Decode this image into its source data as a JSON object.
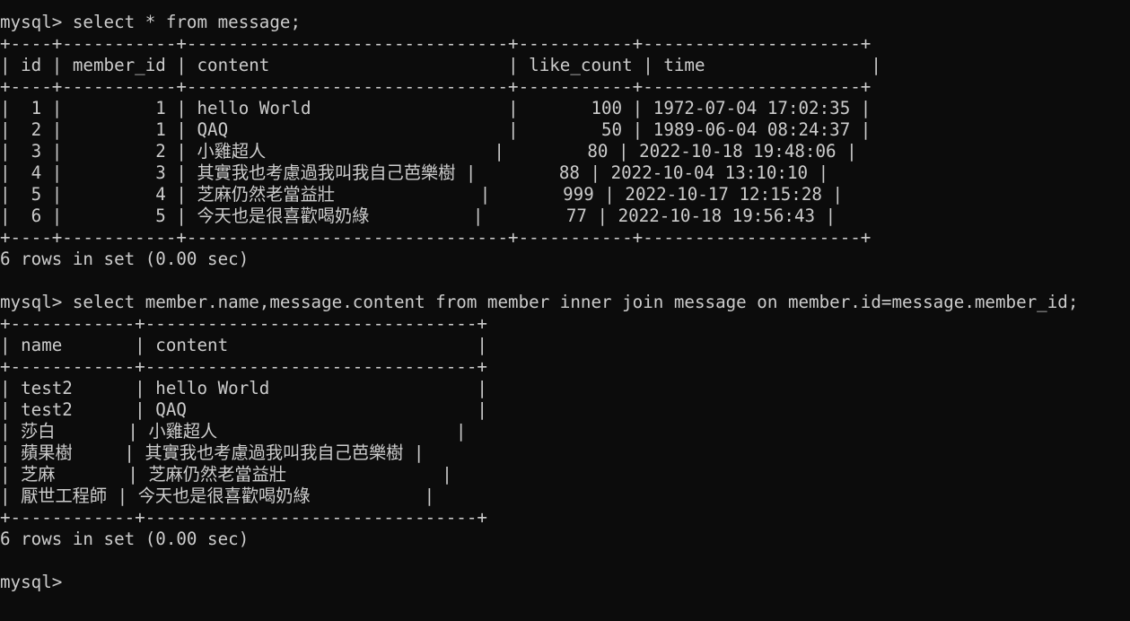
{
  "theme": {
    "background": "#0c0c0c",
    "foreground": "#cccccc"
  },
  "lines": [
    "mysql> select * from message;",
    "+----+-----------+-------------------------------+-----------+---------------------+",
    "| id | member_id | content                       | like_count | time                |",
    "+----+-----------+-------------------------------+-----------+---------------------+",
    "|  1 |         1 | hello World                   |       100 | 1972-07-04 17:02:35 |",
    "|  2 |         1 | QAQ                           |        50 | 1989-06-04 08:24:37 |",
    "|  3 |         2 | 小雞超人                      |        80 | 2022-10-18 19:48:06 |",
    "|  4 |         3 | 其實我也考慮過我叫我自己芭樂樹 |        88 | 2022-10-04 13:10:10 |",
    "|  5 |         4 | 芝麻仍然老當益壯              |       999 | 2022-10-17 12:15:28 |",
    "|  6 |         5 | 今天也是很喜歡喝奶綠          |        77 | 2022-10-18 19:56:43 |",
    "+----+-----------+-------------------------------+-----------+---------------------+",
    "6 rows in set (0.00 sec)",
    "",
    "mysql> select member.name,message.content from member inner join message on member.id=message.member_id;",
    "+------------+--------------------------------+",
    "| name       | content                        |",
    "+------------+--------------------------------+",
    "| test2      | hello World                    |",
    "| test2      | QAQ                            |",
    "| 莎白       | 小雞超人                       |",
    "| 蘋果樹     | 其實我也考慮過我叫我自己芭樂樹 |",
    "| 芝麻       | 芝麻仍然老當益壯               |",
    "| 厭世工程師 | 今天也是很喜歡喝奶綠           |",
    "+------------+--------------------------------+",
    "6 rows in set (0.00 sec)",
    "",
    "mysql>"
  ]
}
